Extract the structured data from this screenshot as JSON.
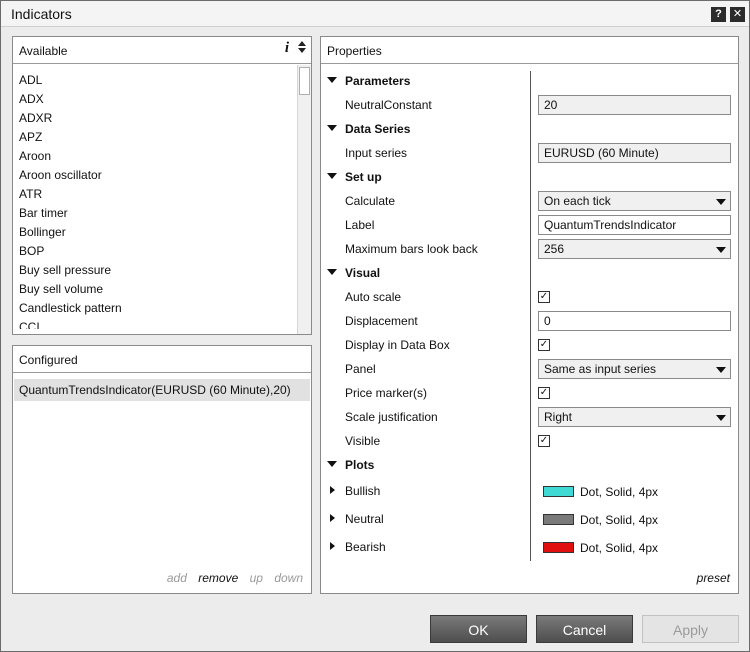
{
  "window": {
    "title": "Indicators",
    "help_label": "?",
    "close_label": "✕"
  },
  "available": {
    "header": "Available",
    "info_label": "i",
    "items": [
      "ADL",
      "ADX",
      "ADXR",
      "APZ",
      "Aroon",
      "Aroon oscillator",
      "ATR",
      "Bar timer",
      "Bollinger",
      "BOP",
      "Buy sell pressure",
      "Buy sell volume",
      "Candlestick pattern",
      "CCI"
    ]
  },
  "configured": {
    "header": "Configured",
    "item": "QuantumTrendsIndicator(EURUSD (60 Minute),20)",
    "actions": {
      "add": "add",
      "remove": "remove",
      "up": "up",
      "down": "down"
    }
  },
  "properties": {
    "header": "Properties",
    "categories": {
      "parameters": "Parameters",
      "data_series": "Data Series",
      "setup": "Set up",
      "visual": "Visual",
      "plots": "Plots"
    },
    "neutral_constant": {
      "label": "NeutralConstant",
      "value": "20"
    },
    "input_series": {
      "label": "Input series",
      "value": "EURUSD (60 Minute)"
    },
    "calculate": {
      "label": "Calculate",
      "value": "On each tick"
    },
    "label_field": {
      "label": "Label",
      "value": "QuantumTrendsIndicator"
    },
    "max_bars": {
      "label": "Maximum bars look back",
      "value": "256"
    },
    "auto_scale": {
      "label": "Auto scale",
      "checked": "✓"
    },
    "displacement": {
      "label": "Displacement",
      "value": "0"
    },
    "data_box": {
      "label": "Display in Data Box",
      "checked": "✓"
    },
    "panel": {
      "label": "Panel",
      "value": "Same as input series"
    },
    "price_marker": {
      "label": "Price marker(s)",
      "checked": "✓"
    },
    "scale_justification": {
      "label": "Scale justification",
      "value": "Right"
    },
    "visible": {
      "label": "Visible",
      "checked": "✓"
    },
    "plots": [
      {
        "name": "Bullish",
        "desc": "Dot, Solid, 4px",
        "color": "#40d9d3"
      },
      {
        "name": "Neutral",
        "desc": "Dot, Solid, 4px",
        "color": "#7a7a7a"
      },
      {
        "name": "Bearish",
        "desc": "Dot, Solid, 4px",
        "color": "#e01010"
      }
    ],
    "preset": "preset"
  },
  "buttons": {
    "ok": "OK",
    "cancel": "Cancel",
    "apply": "Apply"
  }
}
